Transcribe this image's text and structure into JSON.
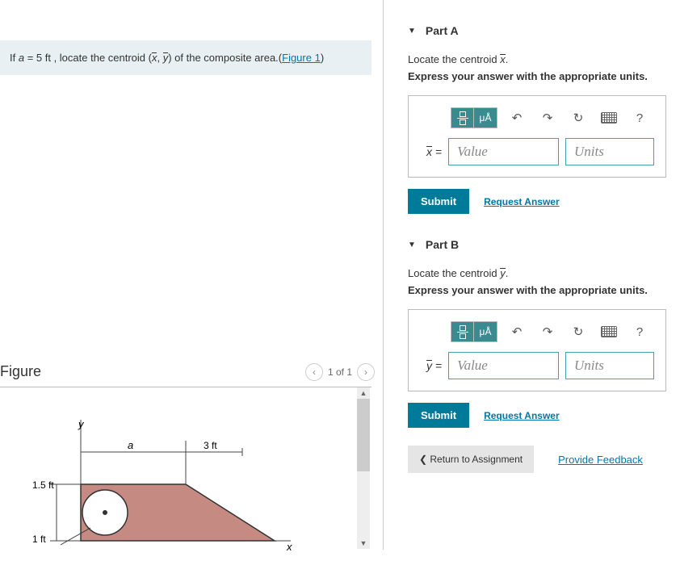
{
  "problem": {
    "prefix": "If ",
    "var": "a",
    "eq": " = 5 ft , locate the centroid (",
    "xbar": "x",
    "comma": ", ",
    "ybar": "y",
    "suffix": ") of the composite area.(",
    "figlink": "Figure 1",
    "close": ")"
  },
  "figure": {
    "title": "Figure",
    "counter": "1 of 1",
    "labels": {
      "y": "y",
      "x": "x",
      "a": "a",
      "d3ft": "3 ft",
      "d15ft": "1.5 ft",
      "d1ft": "1 ft"
    }
  },
  "partA": {
    "header": "Part A",
    "instr": "Locate the centroid ",
    "sym": "x",
    "period": ".",
    "bold": "Express your answer with the appropriate units.",
    "varlabel": "x",
    "eq": " = ",
    "value_ph": "Value",
    "units_ph": "Units",
    "submit": "Submit",
    "request": "Request Answer",
    "mu": "μÅ",
    "help": "?"
  },
  "partB": {
    "header": "Part B",
    "instr": "Locate the centroid ",
    "sym": "y",
    "period": ".",
    "bold": "Express your answer with the appropriate units.",
    "varlabel": "y",
    "eq": " = ",
    "value_ph": "Value",
    "units_ph": "Units",
    "submit": "Submit",
    "request": "Request Answer",
    "mu": "μÅ",
    "help": "?"
  },
  "footer": {
    "return": "Return to Assignment",
    "feedback": "Provide Feedback"
  }
}
